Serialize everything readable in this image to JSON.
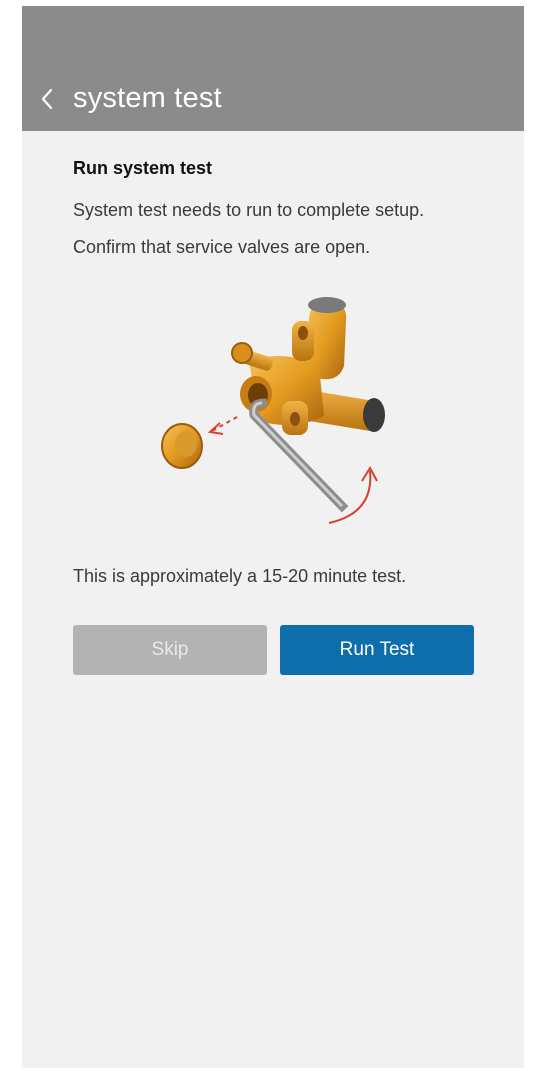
{
  "header": {
    "title": "system test",
    "back_icon": "chevron-left-icon"
  },
  "main": {
    "heading": "Run system test",
    "line1": "System test needs to run to complete setup.",
    "line2": "Confirm that service valves are open.",
    "illustration": "service-valve-hex-key-illustration",
    "duration_note": "This is approximately a 15-20 minute test."
  },
  "buttons": {
    "skip_label": "Skip",
    "run_label": "Run Test"
  },
  "colors": {
    "header_bg": "#8b8b8b",
    "page_bg": "#f1f1f1",
    "primary": "#0e6eab",
    "disabled": "#b3b3b3",
    "valve_gold": "#e39a1f",
    "arrow_red": "#d9402f"
  }
}
